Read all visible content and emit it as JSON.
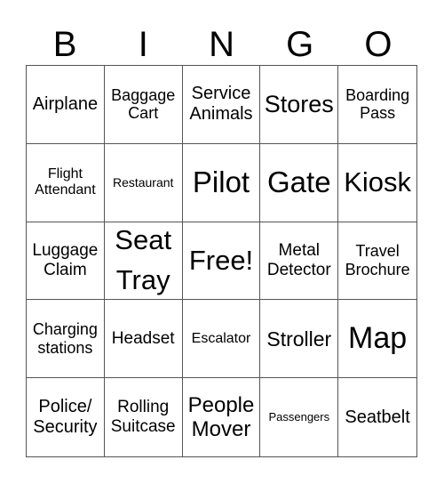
{
  "header": [
    "B",
    "I",
    "N",
    "G",
    "O"
  ],
  "cells": [
    [
      "Airplane",
      "Baggage Cart",
      "Service Animals",
      "Stores",
      "Boarding Pass"
    ],
    [
      "Flight Attendant",
      "Restaurant",
      "Pilot",
      "Gate",
      "Kiosk"
    ],
    [
      "Luggage Claim",
      "Seat Tray",
      "Free!",
      "Metal Detector",
      "Travel Brochure"
    ],
    [
      "Charging stations",
      "Headset",
      "Escalator",
      "Stroller",
      "Map"
    ],
    [
      "Police/ Security",
      "Rolling Suitcase",
      "People Mover",
      "Passengers",
      "Seatbelt"
    ]
  ]
}
